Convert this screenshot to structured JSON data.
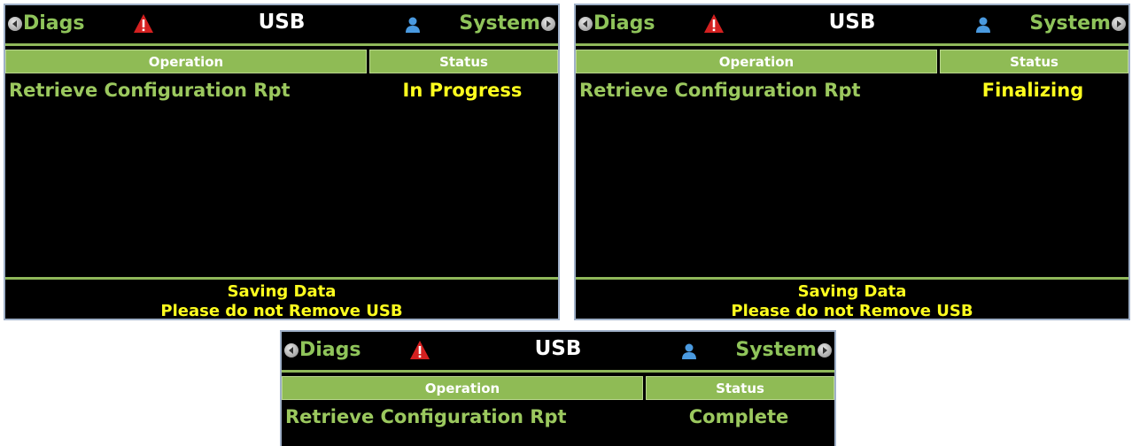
{
  "panels": [
    {
      "header": {
        "left_label": "Diags",
        "title": "USB",
        "right_label": "System"
      },
      "table": {
        "col_operation": "Operation",
        "col_status": "Status"
      },
      "row": {
        "operation": "Retrieve Configuration Rpt",
        "status": "In Progress",
        "status_color": "#ffff1e"
      },
      "footer": {
        "line1": "Saving Data",
        "line2": "Please do not Remove USB"
      }
    },
    {
      "header": {
        "left_label": "Diags",
        "title": "USB",
        "right_label": "System"
      },
      "table": {
        "col_operation": "Operation",
        "col_status": "Status"
      },
      "row": {
        "operation": "Retrieve Configuration Rpt",
        "status": "Finalizing",
        "status_color": "#ffff1e"
      },
      "footer": {
        "line1": "Saving Data",
        "line2": "Please do not Remove USB"
      }
    },
    {
      "header": {
        "left_label": "Diags",
        "title": "USB",
        "right_label": "System"
      },
      "table": {
        "col_operation": "Operation",
        "col_status": "Status"
      },
      "row": {
        "operation": "Retrieve Configuration Rpt",
        "status": "Complete",
        "status_color": "#9bc85e"
      }
    }
  ],
  "colors": {
    "accent_green": "#8fbb55",
    "text_green": "#9bc85e",
    "text_yellow": "#ffff1e",
    "background": "#000000"
  },
  "icons": {
    "left_nav": "chevron-left-icon",
    "warning": "warning-icon",
    "user": "user-icon",
    "right_nav": "chevron-right-icon"
  }
}
